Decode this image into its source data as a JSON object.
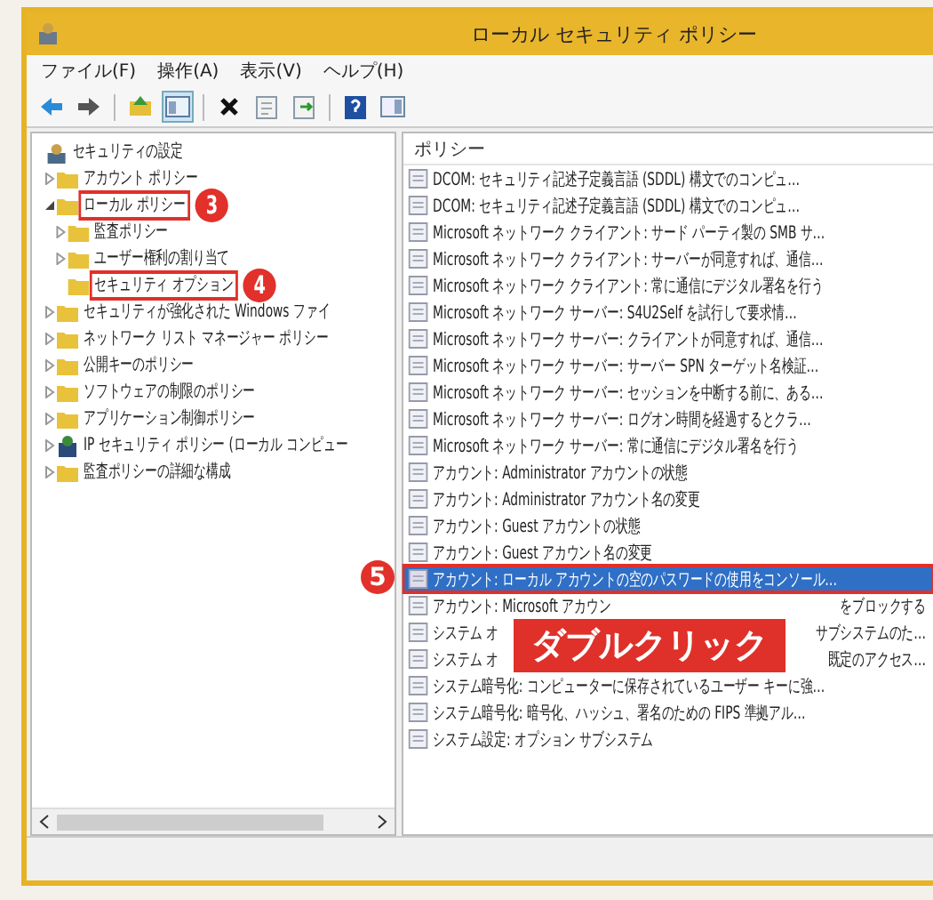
{
  "window": {
    "title": "ローカル セキュリティ ポリシー"
  },
  "menu": [
    "ファイル(F)",
    "操作(A)",
    "表示(V)",
    "ヘルプ(H)"
  ],
  "toolbar": [
    {
      "kind": "back",
      "pressed": false
    },
    {
      "kind": "forward",
      "pressed": false
    },
    {
      "kind": "sep"
    },
    {
      "kind": "up",
      "pressed": false
    },
    {
      "kind": "tree",
      "pressed": true
    },
    {
      "kind": "sep"
    },
    {
      "kind": "delete",
      "pressed": false
    },
    {
      "kind": "props",
      "pressed": false
    },
    {
      "kind": "export",
      "pressed": false
    },
    {
      "kind": "sep"
    },
    {
      "kind": "help",
      "pressed": false
    },
    {
      "kind": "pane",
      "pressed": false
    }
  ],
  "tree": [
    {
      "label": "セキュリティの設定",
      "kind": "root",
      "children": [
        {
          "label": "アカウント ポリシー",
          "kind": "folder",
          "expanded": false
        },
        {
          "label": "ローカル ポリシー",
          "kind": "folder",
          "expanded": true,
          "callout": "3",
          "children": [
            {
              "label": "監査ポリシー",
              "kind": "folder",
              "expanded": false
            },
            {
              "label": "ユーザー権利の割り当て",
              "kind": "folder",
              "expanded": false
            },
            {
              "label": "セキュリティ オプション",
              "kind": "folder",
              "callout": "4"
            }
          ]
        },
        {
          "label": "セキュリティが強化された Windows ファイ",
          "kind": "folder",
          "expanded": false
        },
        {
          "label": "ネットワーク リスト マネージャー ポリシー",
          "kind": "folder",
          "expanded": false
        },
        {
          "label": "公開キーのポリシー",
          "kind": "folder",
          "expanded": false
        },
        {
          "label": "ソフトウェアの制限のポリシー",
          "kind": "folder",
          "expanded": false
        },
        {
          "label": "アプリケーション制御ポリシー",
          "kind": "folder",
          "expanded": false
        },
        {
          "label": "IP セキュリティ ポリシー (ローカル コンピュー",
          "kind": "shield",
          "expanded": false
        },
        {
          "label": "監査ポリシーの詳細な構成",
          "kind": "folder",
          "expanded": false
        }
      ]
    }
  ],
  "list": {
    "column": "ポリシー",
    "rows": [
      {
        "texts": [
          "DCOM: セキュリティ記述子定義言語 (SDDL) 構文でのコンピュ…"
        ],
        "selected": false
      },
      {
        "texts": [
          "DCOM: セキュリティ記述子定義言語 (SDDL) 構文でのコンピュ…"
        ],
        "selected": false
      },
      {
        "texts": [
          "Microsoft ネットワーク クライアント: サード パーティ製の SMB サ…"
        ],
        "selected": false
      },
      {
        "texts": [
          "Microsoft ネットワーク クライアント: サーバーが同意すれば、通信…"
        ],
        "selected": false
      },
      {
        "texts": [
          "Microsoft ネットワーク クライアント: 常に通信にデジタル署名を行う"
        ],
        "selected": false
      },
      {
        "texts": [
          "Microsoft ネットワーク サーバー: S4U2Self を試行して要求情…"
        ],
        "selected": false
      },
      {
        "texts": [
          "Microsoft ネットワーク サーバー: クライアントが同意すれば、通信…"
        ],
        "selected": false
      },
      {
        "texts": [
          "Microsoft ネットワーク サーバー: サーバー SPN ターゲット名検証…"
        ],
        "selected": false
      },
      {
        "texts": [
          "Microsoft ネットワーク サーバー: セッションを中断する前に、ある…"
        ],
        "selected": false
      },
      {
        "texts": [
          "Microsoft ネットワーク サーバー: ログオン時間を経過するとクラ…"
        ],
        "selected": false
      },
      {
        "texts": [
          "Microsoft ネットワーク サーバー: 常に通信にデジタル署名を行う"
        ],
        "selected": false
      },
      {
        "texts": [
          "アカウント: Administrator アカウントの状態"
        ],
        "selected": false
      },
      {
        "texts": [
          "アカウント: Administrator アカウント名の変更"
        ],
        "selected": false
      },
      {
        "texts": [
          "アカウント: Guest アカウントの状態"
        ],
        "selected": false
      },
      {
        "texts": [
          "アカウント: Guest アカウント名の変更"
        ],
        "selected": false
      },
      {
        "texts": [
          "アカウント: ローカル アカウントの空のパスワードの使用をコンソール…"
        ],
        "selected": true,
        "callout": "5"
      },
      {
        "texts": [
          "アカウント: Microsoft アカウン",
          "をブロックする"
        ],
        "selected": false
      },
      {
        "texts": [
          "システム オ",
          "サブシステムのた…"
        ],
        "selected": false
      },
      {
        "texts": [
          "システム オ",
          "既定のアクセス…"
        ],
        "selected": false
      },
      {
        "texts": [
          "システム暗号化: コンピューターに保存されているユーザー キーに強…"
        ],
        "selected": false
      },
      {
        "texts": [
          "システム暗号化: 暗号化、ハッシュ、署名のための FIPS 準拠アル…"
        ],
        "selected": false
      },
      {
        "texts": [
          "システム設定: オプション サブシステム"
        ],
        "selected": false
      }
    ]
  },
  "overlay_label": "ダブルクリック"
}
